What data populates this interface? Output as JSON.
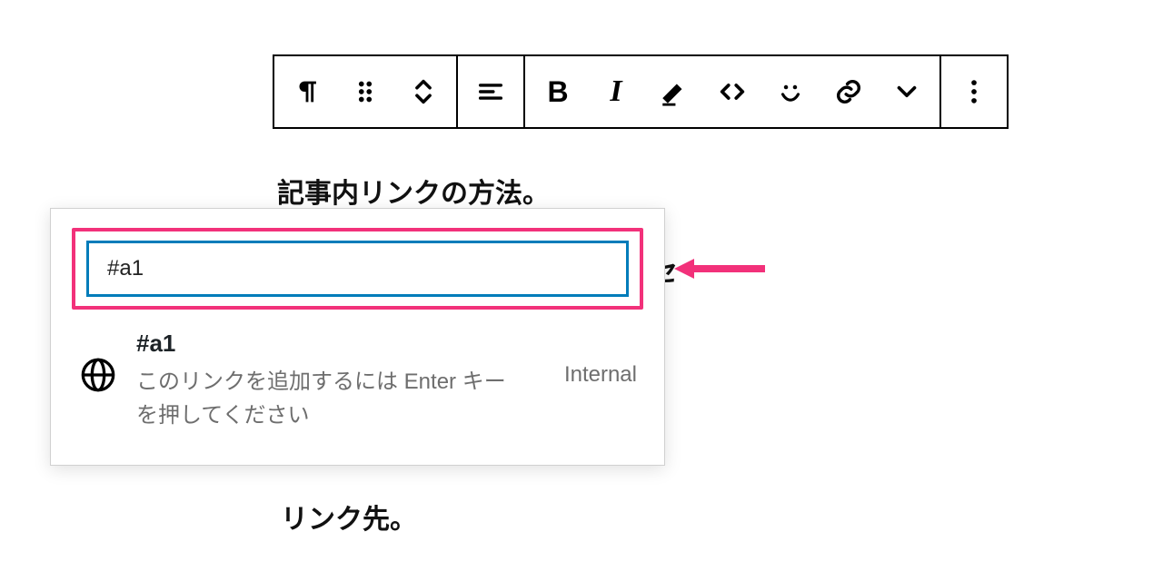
{
  "toolbar": {
    "groups": [
      [
        "paragraph",
        "drag",
        "move-updown"
      ],
      [
        "align"
      ],
      [
        "bold",
        "italic",
        "highlight",
        "code",
        "smiley",
        "link",
        "chevron-down"
      ],
      [
        "more"
      ]
    ]
  },
  "content": {
    "paragraph_above": "記事内リンクの方法。",
    "paragraph_below": "リンク先。",
    "obscured_char": "セ"
  },
  "link_popup": {
    "input_value": "#a1",
    "suggestion": {
      "title": "#a1",
      "description": "このリンクを追加するには Enter キーを押してください",
      "tag": "Internal"
    }
  },
  "annotation": {
    "arrow_color": "#f2317a"
  }
}
